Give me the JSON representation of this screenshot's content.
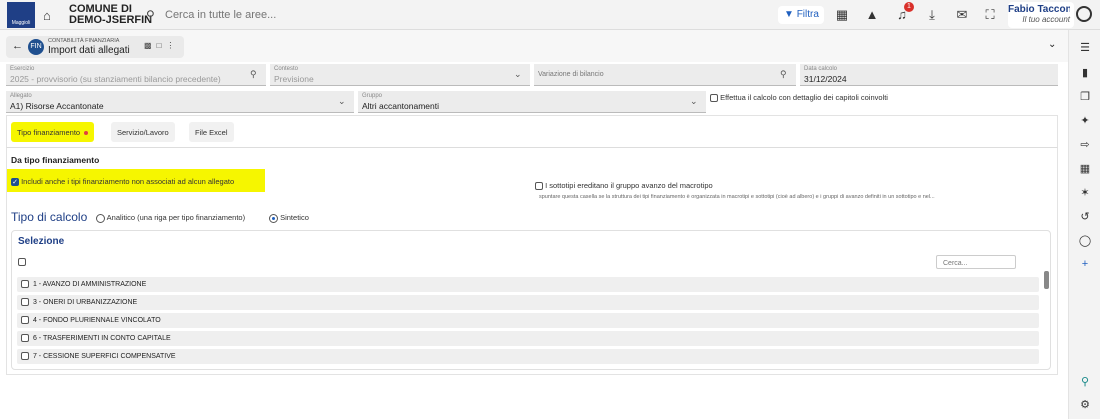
{
  "topbar": {
    "logo_text": "Maggioli",
    "comune_line1": "COMUNE DI",
    "comune_line2": "DEMO-JSERFIN",
    "search_placeholder": "Cerca in tutte le aree...",
    "filter_label": "Filtra",
    "notification_count": "1",
    "user_name": "Fabio Tacconell...",
    "user_sub": "Il tuo account"
  },
  "titlebar": {
    "app_badge": "FIN",
    "breadcrumb": "CONTABILITÀ FINANZIARIA",
    "title": "Import dati allegati"
  },
  "form": {
    "esercizio_label": "Esercizio",
    "esercizio_value": "2025 - provvisorio (su stanziamenti bilancio precedente)",
    "contesto_label": "Contesto",
    "contesto_value": "Previsione",
    "variazione_placeholder": "Variazione di bilancio",
    "data_calcolo_label": "Data calcolo",
    "data_calcolo_value": "31/12/2024",
    "allegato_label": "Allegato",
    "allegato_value": "A1) Risorse Accantonate",
    "gruppo_label": "Gruppo",
    "gruppo_value": "Altri accantonamenti",
    "dettaglio_label": "Effettua il calcolo con dettaglio dei capitoli coinvolti"
  },
  "tabs": [
    {
      "label": "Tipo finanziamento"
    },
    {
      "label": "Servizio/Lavoro"
    },
    {
      "label": "File Excel"
    }
  ],
  "section": {
    "title": "Da tipo finanziamento",
    "includi_label": "Includi anche i tipi finanziamento non associati ad alcun allegato",
    "sottotipi_label": "I sottotipi ereditano il gruppo avanzo del macrotipo",
    "sottotipi_help": "spuntare questa casella se la struttura dei tipi finanziamento è organizzata in macrotipi e sottotipi (cioè ad albero) e i gruppi di avanzo definiti in un sottotipo e nel...",
    "tipo_calcolo_title": "Tipo di calcolo",
    "radio_analitico": "Analitico (una riga per tipo finanziamento)",
    "radio_sintetico": "Sintetico"
  },
  "selezione": {
    "title": "Selezione",
    "search_placeholder": "Cerca...",
    "rows": [
      "1 - AVANZO DI AMMINISTRAZIONE",
      "3 - ONERI DI URBANIZZAZIONE",
      "4 - FONDO PLURIENNALE VINCOLATO",
      "6 - TRASFERIMENTI IN CONTO CAPITALE",
      "7 - CESSIONE SUPERFICI COMPENSATIVE"
    ]
  },
  "colors": {
    "highlight": "#f6f600",
    "brand": "#1f3f86",
    "accent": "#1f5fbf",
    "badge": "#d9302a"
  }
}
